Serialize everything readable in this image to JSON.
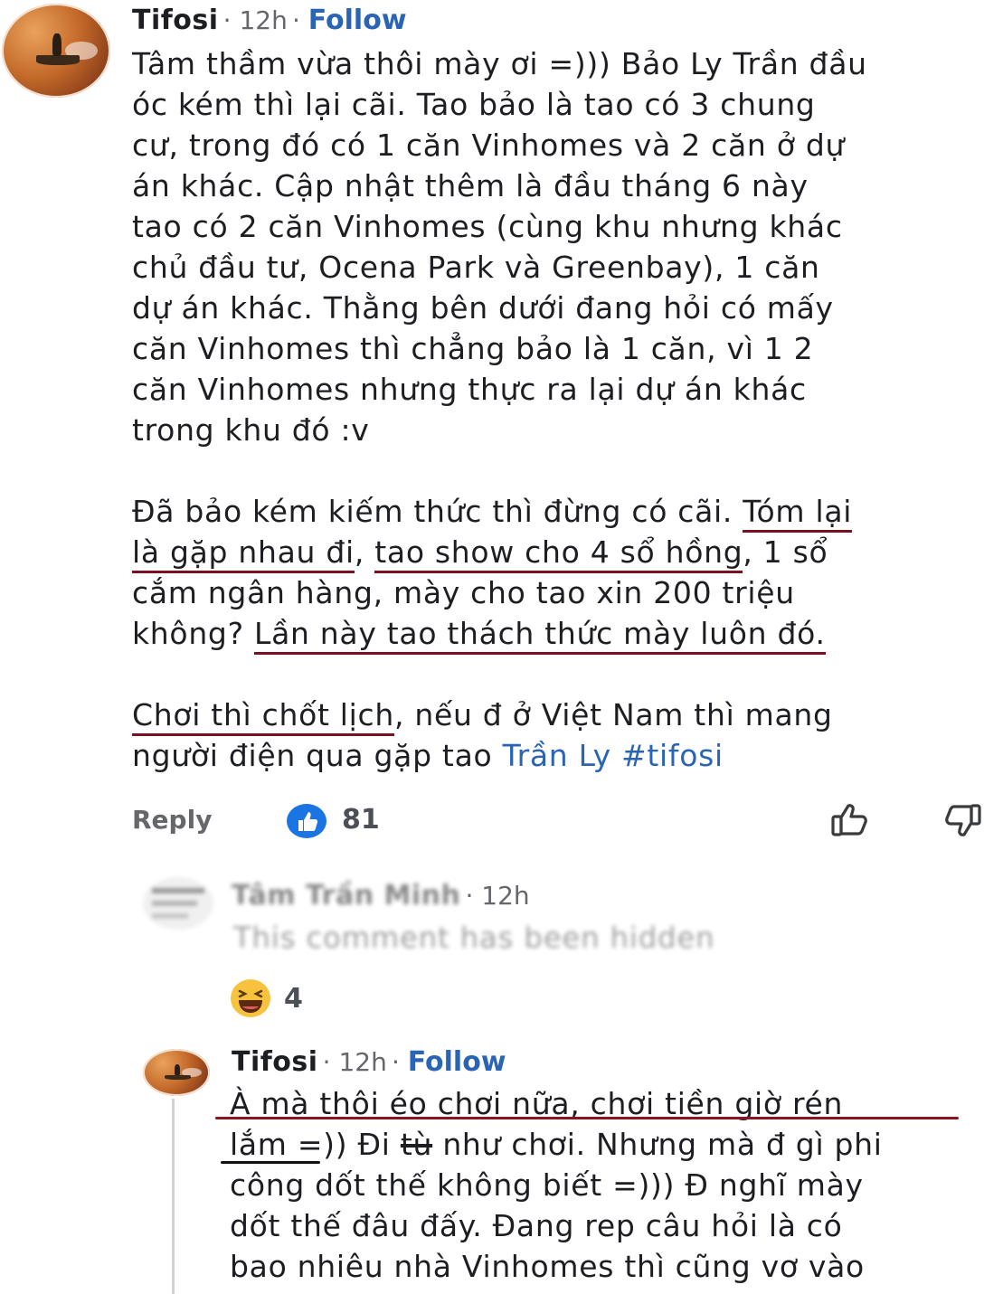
{
  "main_comment": {
    "author": "Tifosi",
    "time": "12h",
    "follow_label": "Follow",
    "paragraph1_lines": [
      "Tâm thầm vừa thôi mày ơi =))) Bảo Ly Trần đầu",
      "óc kém thì lại cãi. Tao bảo là tao có 3 chung",
      "cư, trong đó có 1 căn Vinhomes và 2 căn ở dự",
      "án khác. Cập nhật thêm là đầu tháng 6 này",
      "tao có 2 căn Vinhomes (cùng khu nhưng khác",
      "chủ đầu tư, Ocena Park và Greenbay), 1 căn",
      "dự án khác. Thằng bên dưới đang hỏi có mấy",
      "căn Vinhomes thì chẳng bảo là 1 căn, vì 1 2",
      "căn Vinhomes nhưng thực ra lại dự án khác",
      "trong khu đó :v"
    ],
    "p2_l1_pre": "Đã bảo kém kiếm thức thì đừng có cãi. ",
    "p2_l1_ul": "Tóm lại",
    "p2_l2_ul1": "là gặp nhau đi",
    "p2_l2_mid": ", ",
    "p2_l2_ul2": "tao show cho 4 sổ hồng",
    "p2_l2_post": ", 1 sổ",
    "p2_l3": "cắm ngân hàng, mày cho tao xin 200 triệu",
    "p2_l4_pre": "không? ",
    "p2_l4_ul": "Lần này tao thách thức mày luôn đó.",
    "p3_l1_ul": "Chơi thì chốt lịch",
    "p3_l1_post": ", nếu đ ở Việt Nam thì mang",
    "p3_l2_pre": "người điện qua gặp tao ",
    "p3_l2_link": "Trần Ly #tifosi",
    "reply_label": "Reply",
    "like_count": "81"
  },
  "hidden_reply": {
    "author": "Tâm Trần Minh",
    "time": "12h",
    "hidden_text": "This comment has been hidden",
    "reaction_count": "4"
  },
  "second_reply": {
    "author": "Tifosi",
    "time": "12h",
    "follow_label": "Follow",
    "l1": "À mà thôi éo chơi nữa, chơi tiền giờ rén",
    "l2_pre": "lắm =)) Đi ",
    "l2_strike": "tù",
    "l2_post": " như chơi. Nhưng mà đ gì phi",
    "l3": "công dốt thế không biết =))) Đ nghĩ mày",
    "l4": "dốt thế đâu đấy. Đang rep câu hỏi là có",
    "l5": "bao nhiêu nhà Vinhomes thì cũng vơ vào"
  },
  "colors": {
    "link": "#2a64b4",
    "underline": "#8a1426",
    "like_blue": "#1b74e4"
  }
}
